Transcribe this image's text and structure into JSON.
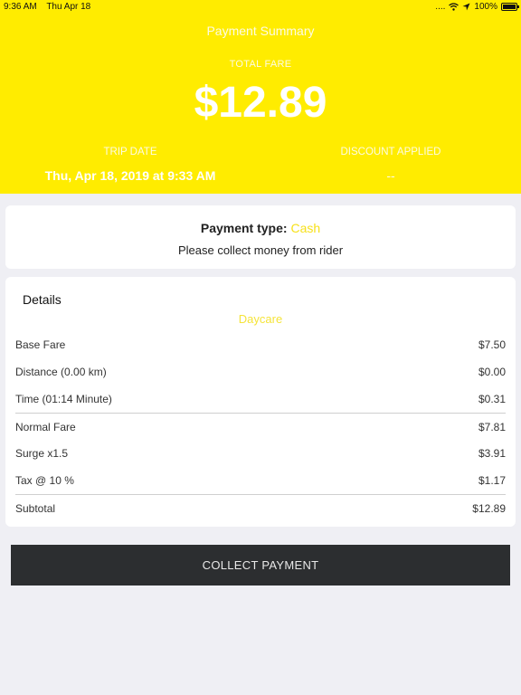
{
  "status_bar": {
    "time": "9:36 AM",
    "date": "Thu Apr 18",
    "signal": "....",
    "battery": "100%"
  },
  "header": {
    "title": "Payment Summary",
    "total_fare_label": "TOTAL FARE",
    "total_fare": "$12.89",
    "trip_date_label": "TRIP DATE",
    "trip_date": "Thu, Apr 18, 2019 at 9:33 AM",
    "discount_label": "DISCOUNT APPLIED",
    "discount": "--"
  },
  "payment": {
    "type_label": "Payment type:",
    "type": "Cash",
    "note": "Please collect money from rider"
  },
  "details": {
    "title": "Details",
    "vehicle_type": "Daycare",
    "rows": [
      {
        "label": "Base Fare",
        "value": "$7.50"
      },
      {
        "label": "Distance (0.00 km)",
        "value": "$0.00"
      },
      {
        "label": "Time (01:14 Minute)",
        "value": "$0.31"
      },
      {
        "label": "Normal Fare",
        "value": "$7.81"
      },
      {
        "label": "Surge x1.5",
        "value": "$3.91"
      },
      {
        "label": "Tax @ 10 %",
        "value": "$1.17"
      },
      {
        "label": "Subtotal",
        "value": "$12.89"
      }
    ]
  },
  "actions": {
    "collect_label": "COLLECT PAYMENT"
  },
  "colors": {
    "accent": "#ffec00",
    "cash": "#f7e11a",
    "button": "#2c2e30"
  },
  "icons": {
    "wifi": "wifi-icon",
    "location": "location-arrow-icon",
    "battery": "battery-icon"
  }
}
